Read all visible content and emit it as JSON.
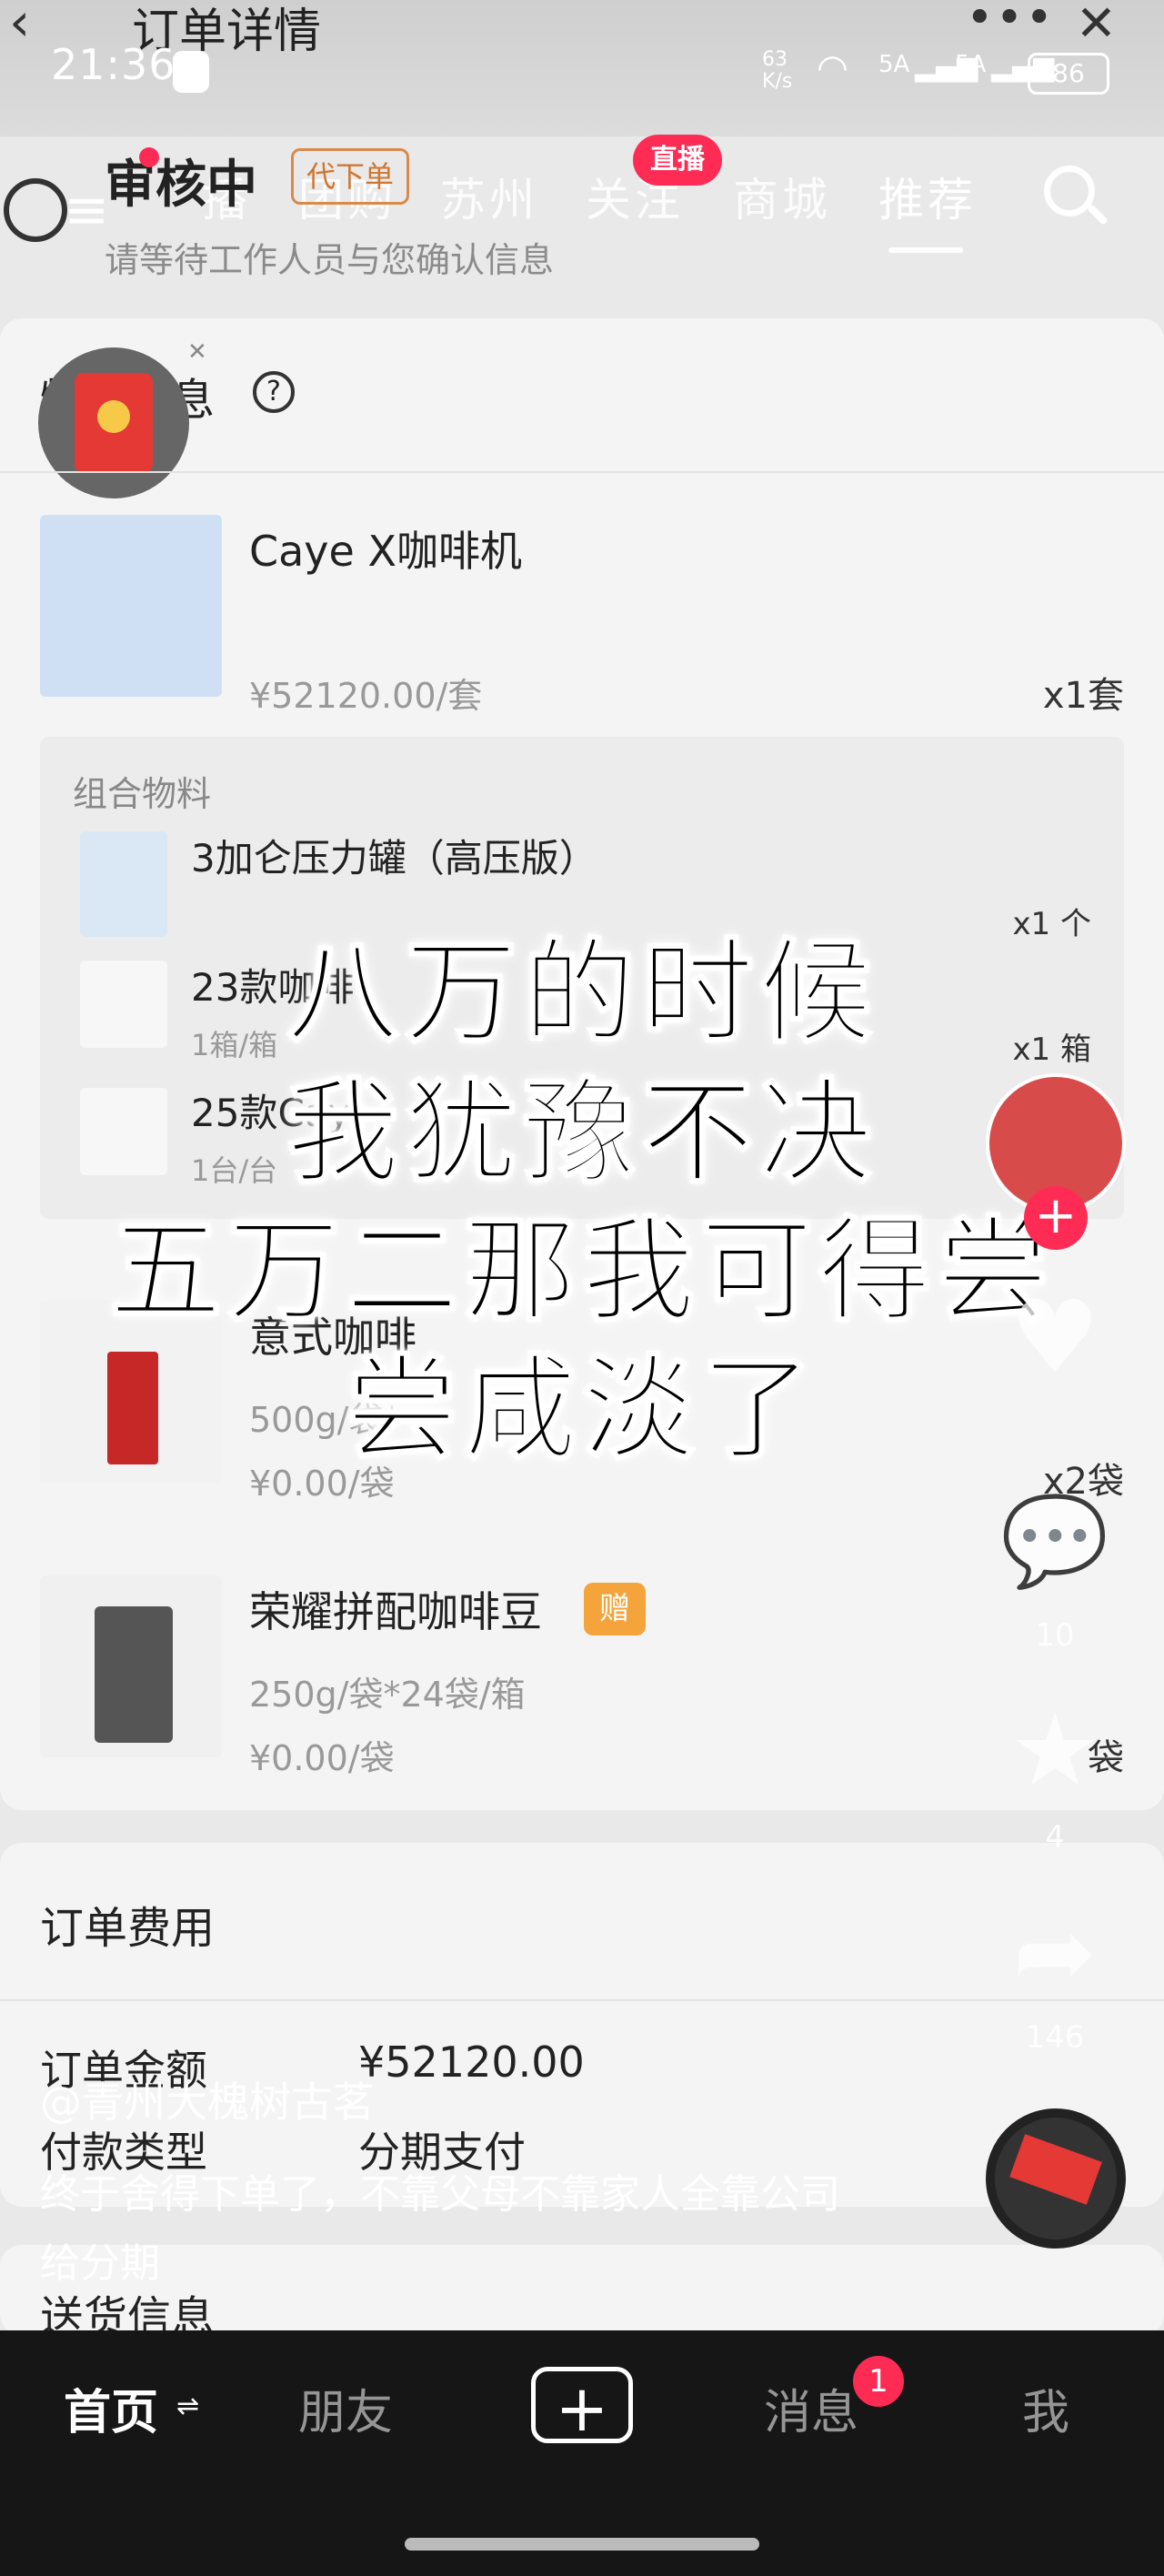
{
  "status_bar": {
    "time": "21:36",
    "net_speed": "63\nK/s",
    "sig1": "5A",
    "sig2": "5A",
    "battery": "86"
  },
  "header": {
    "title": "订单详情"
  },
  "top_nav": {
    "items": [
      "播",
      "团购",
      "苏州",
      "关注",
      "商城",
      "推荐"
    ],
    "live_badge": "直播"
  },
  "order_status": {
    "title": "审核中",
    "tag": "代下单",
    "subtitle": "请等待工作人员与您确认信息"
  },
  "materials": {
    "section_title": "物料信息",
    "products": [
      {
        "name": "Caye X咖啡机",
        "price": "¥52120.00/套",
        "qty": "x1套"
      },
      {
        "name": "意式咖啡",
        "spec": "500g/袋*",
        "price": "¥0.00/袋",
        "qty": "x2袋"
      },
      {
        "name": "荣耀拼配咖啡豆",
        "gift": "赠",
        "spec": "250g/袋*24袋/箱",
        "price": "¥0.00/袋",
        "qty": "袋"
      }
    ],
    "combo": {
      "label": "组合物料",
      "items": [
        {
          "name": "3加仑压力罐（高压版）",
          "qty": "x1 个"
        },
        {
          "name": "23款咖啡",
          "sub": "1箱/箱",
          "qty": "x1 箱"
        },
        {
          "name": "25款Cay",
          "sub": "1台/台",
          "qty": ""
        }
      ]
    }
  },
  "fees": {
    "section_title": "订单费用",
    "order_amount_label": "订单金额",
    "order_amount": "¥52120.00",
    "pay_type_label": "付款类型",
    "pay_type": "分期支付",
    "delivery_title": "送货信息"
  },
  "overlay": {
    "lines": [
      "八万的时候",
      "我犹豫不决",
      "五万二那我可得尝",
      "尝咸淡了"
    ]
  },
  "side_actions": {
    "likes": "",
    "comments": "10",
    "favorites": "4",
    "shares": "146"
  },
  "video": {
    "author": "@青州大槐树古茗",
    "caption": "终于舍得下单了，不靠父母不靠家人全靠公司给分期"
  },
  "bottom_nav": {
    "home": "首页",
    "friends": "朋友",
    "messages": "消息",
    "messages_badge": "1",
    "me": "我"
  },
  "colors": {
    "accent": "#fe2c55",
    "tag": "#d0762e",
    "gift": "#f5a33b"
  }
}
